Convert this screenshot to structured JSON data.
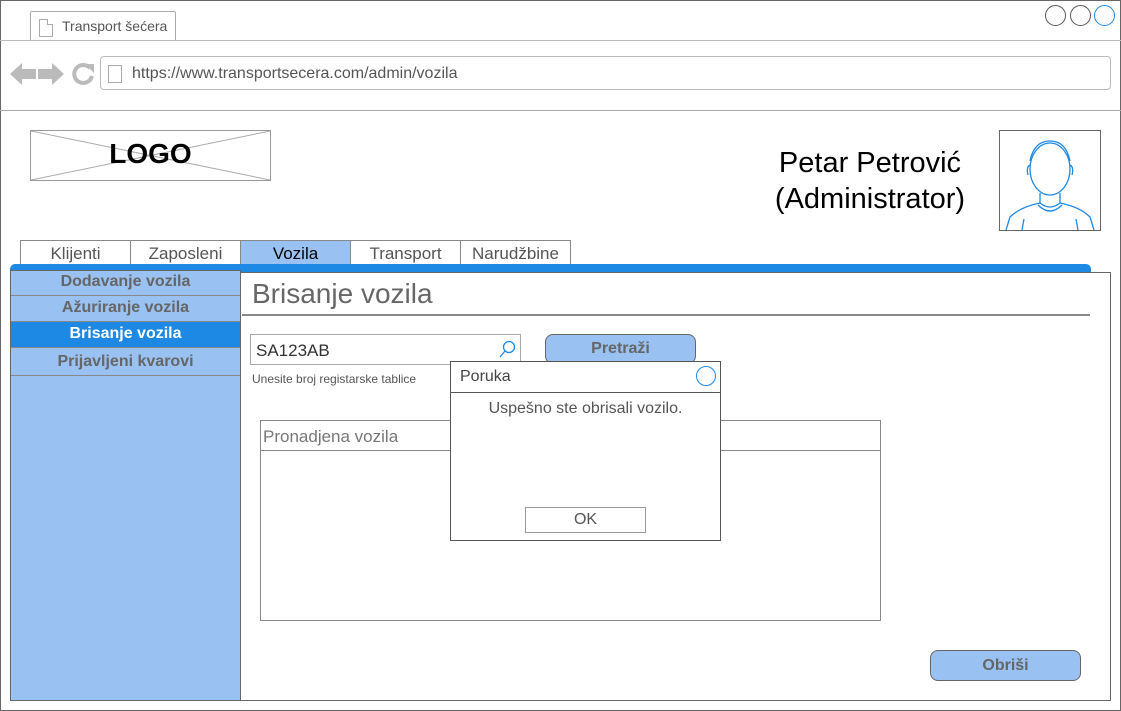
{
  "browser": {
    "tab_title": "Transport šećera",
    "url": "https://www.transportsecera.com/admin/vozila"
  },
  "header": {
    "logo_text": "LOGO",
    "user_name": "Petar Petrović",
    "user_role": "(Administrator)"
  },
  "main_tabs": [
    {
      "label": "Klijenti"
    },
    {
      "label": "Zaposleni"
    },
    {
      "label": "Vozila",
      "active": true
    },
    {
      "label": "Transport"
    },
    {
      "label": "Narudžbine"
    }
  ],
  "sidebar": {
    "items": [
      {
        "label": "Dodavanje vozila"
      },
      {
        "label": "Ažuriranje vozila"
      },
      {
        "label": "Brisanje  vozila",
        "active": true
      },
      {
        "label": "Prijavljeni kvarovi"
      }
    ]
  },
  "main": {
    "title": "Brisanje vozila",
    "search_value": "SA123AB",
    "search_hint": "Unesite broj registarske tablice",
    "search_button": "Pretraži",
    "results_header": "Pronadjena vozila",
    "delete_button": "Obriši"
  },
  "modal": {
    "title": "Poruka",
    "message": "Uspešno ste obrisali vozilo.",
    "ok_button": "OK"
  },
  "colors": {
    "accent": "#1e88e5",
    "light_blue": "#99c1f1"
  }
}
